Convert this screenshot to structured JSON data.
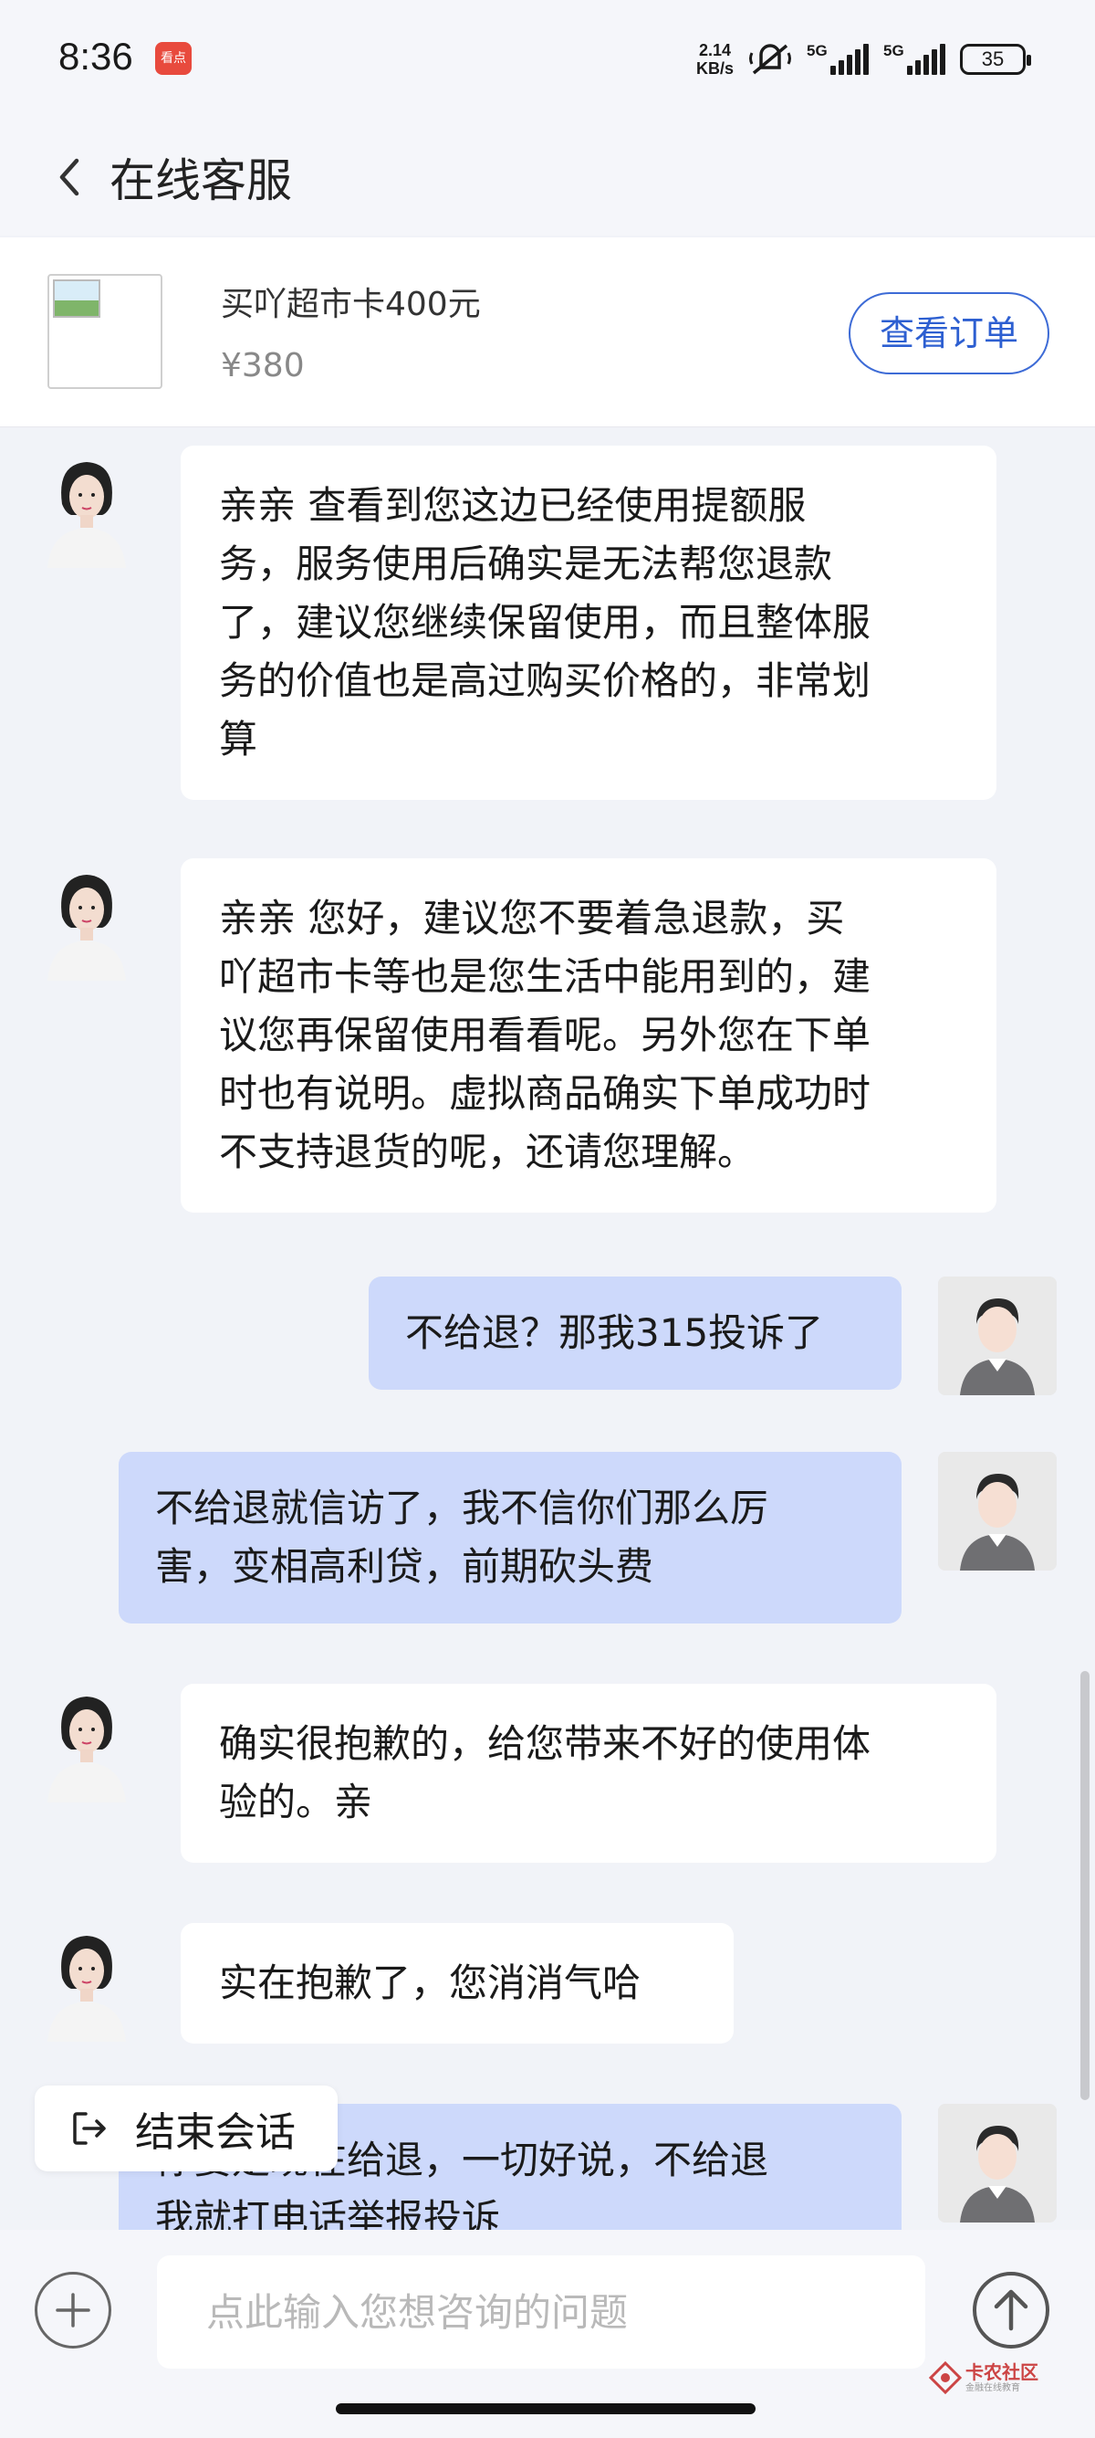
{
  "status_bar": {
    "time": "8:36",
    "app_badge": "看点",
    "net_speed_value": "2.14",
    "net_speed_unit": "KB/s",
    "signal1_tag": "5G",
    "signal2_tag": "5G",
    "battery": "35"
  },
  "header": {
    "title": "在线客服"
  },
  "product": {
    "name": "买吖超市卡400元",
    "price": "¥380",
    "view_order_label": "查看订单"
  },
  "messages": [
    {
      "sender": "agent",
      "text": "亲亲 查看到您这边已经使用提额服\n务，服务使用后确实是无法帮您退款\n了，建议您继续保留使用，而且整体服\n务的价值也是高过购买价格的，非常划\n算"
    },
    {
      "sender": "agent",
      "text": "亲亲 您好，建议您不要着急退款，买\n吖超市卡等也是您生活中能用到的，建\n议您再保留使用看看呢。另外您在下单\n时也有说明。虚拟商品确实下单成功时\n不支持退货的呢，还请您理解。"
    },
    {
      "sender": "user",
      "text": "不给退？那我315投诉了"
    },
    {
      "sender": "user",
      "text": "不给退就信访了，我不信你们那么厉\n害，变相高利贷，前期砍头费"
    },
    {
      "sender": "agent",
      "text": "确实很抱歉的，给您带来不好的使用体\n验的。亲"
    },
    {
      "sender": "agent",
      "text": "实在抱歉了，您消消气哈"
    },
    {
      "sender": "user",
      "text": "你要是现在给退，一切好说，不给退\n我就打电话举报投诉"
    }
  ],
  "end_session": {
    "label": "结束会话"
  },
  "input": {
    "placeholder": "点此输入您想咨询的问题"
  },
  "watermark": {
    "title": "卡农社区",
    "subtitle": "金融在线教育"
  },
  "colors": {
    "user_bubble": "#cdd9fb",
    "agent_bubble": "#ffffff",
    "accent": "#2d5fd1",
    "background": "#f1f3f8"
  }
}
